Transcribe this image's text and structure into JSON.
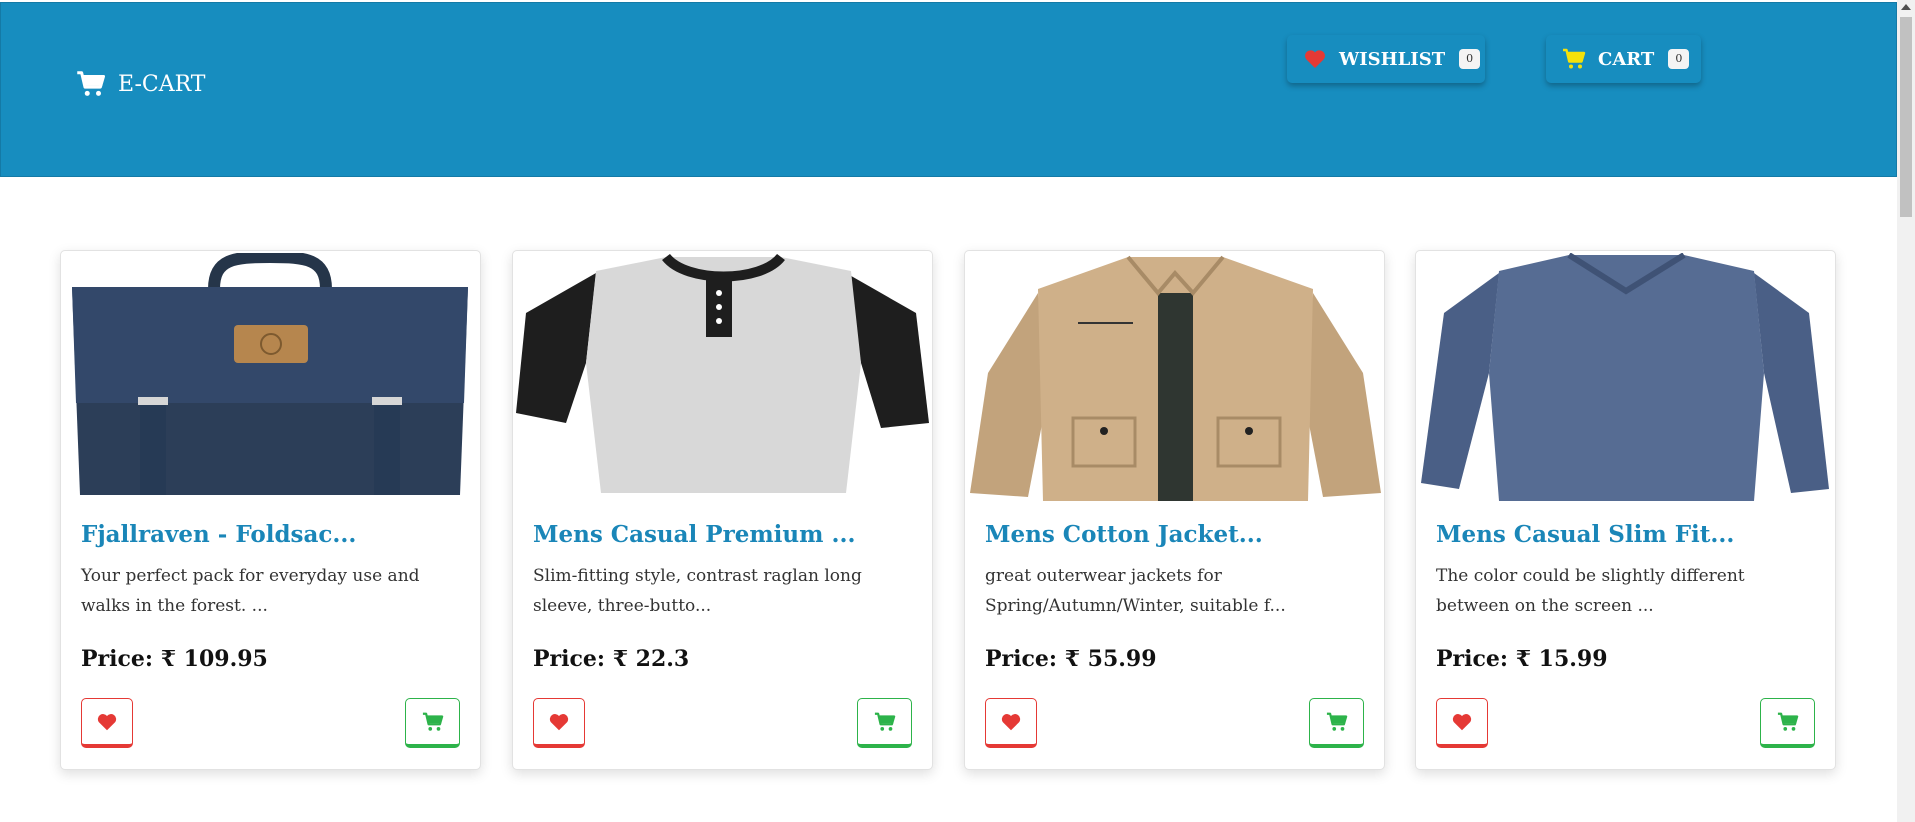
{
  "header": {
    "brand": "E-CART",
    "wishlist_label": "WISHLIST",
    "wishlist_count": "0",
    "cart_label": "CART",
    "cart_count": "0"
  },
  "colors": {
    "header_bg": "#178dbf",
    "title": "#1a86b8",
    "wishlist_red": "#e53935",
    "cart_green": "#2db34a",
    "cart_icon_yellow": "#f5e10a"
  },
  "products": [
    {
      "title": "Fjallraven - Foldsac...",
      "description": "Your perfect pack for everyday use and walks in the forest. ...",
      "price_label": "Price:",
      "price": "₹ 109.95",
      "image": "backpack-image"
    },
    {
      "title": "Mens Casual Premium ...",
      "description": "Slim-fitting style, contrast raglan long sleeve, three-butto...",
      "price_label": "Price:",
      "price": "₹ 22.3",
      "image": "raglan-tshirt-image"
    },
    {
      "title": "Mens Cotton Jacket...",
      "description": "great outerwear jackets for Spring/Autumn/Winter, suitable f...",
      "price_label": "Price:",
      "price": "₹ 55.99",
      "image": "cotton-jacket-image"
    },
    {
      "title": "Mens Casual Slim Fit...",
      "description": "The color could be slightly different between on the screen ...",
      "price_label": "Price:",
      "price": "₹ 15.99",
      "image": "slim-fit-tshirt-image"
    }
  ]
}
